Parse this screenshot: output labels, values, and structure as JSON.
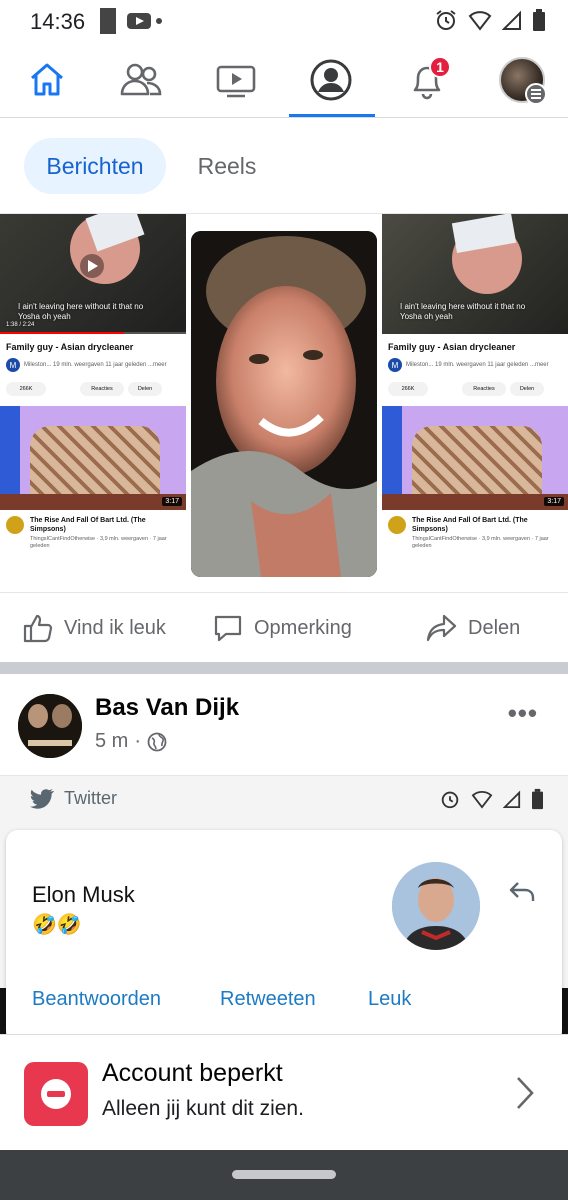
{
  "status_bar": {
    "time": "14:36"
  },
  "nav": {
    "items": [
      {
        "name": "home",
        "icon": "home-icon",
        "active": false
      },
      {
        "name": "friends",
        "icon": "friends-icon",
        "active": false
      },
      {
        "name": "video",
        "icon": "video-icon",
        "active": false
      },
      {
        "name": "profile",
        "icon": "profile-icon",
        "active": true
      },
      {
        "name": "notifications",
        "icon": "bell-icon",
        "active": false
      },
      {
        "name": "menu",
        "icon": "menu-avatar-icon",
        "active": false
      }
    ],
    "notification_count": "1"
  },
  "filter_chips": {
    "posts": "Berichten",
    "reels": "Reels"
  },
  "post1": {
    "yt_left": {
      "subtitle": "I ain't leaving here without it that no\nYosha oh yeah",
      "time": "1:38 / 2:24",
      "title": "Family guy - Asian drycleaner",
      "channel_meta": "Mileston...  19 mln. weergaven  11 jaar geleden  ...meer",
      "likes": "266K",
      "reactions": "Reacties",
      "share": "Delen",
      "title2": "The Rise And Fall Of Bart Ltd. (The Simpsons)",
      "meta2": "ThingsICantFindOtherwise · 3,9 mln. weergaven · 7 jaar geleden",
      "duration": "3:17"
    },
    "yt_right": {
      "subtitle": "I ain't leaving here without it that no\nYosha oh yeah",
      "title": "Family guy - Asian drycleaner",
      "channel_meta": "Mileston...  19 mln. weergaven  11 jaar geleden  ...meer",
      "likes": "266K",
      "reactions": "Reacties",
      "share": "Delen",
      "title2": "The Rise And Fall Of Bart Ltd. (The Simpsons)",
      "meta2": "ThingsICantFindOtherwise · 3,9 mln. weergaven · 7 jaar geleden",
      "duration": "3:17"
    },
    "actions": {
      "like": "Vind ik leuk",
      "comment": "Opmerking",
      "share": "Delen"
    }
  },
  "post2": {
    "author": "Bas Van Dijk",
    "time": "5 m",
    "tweet": {
      "source": "Twitter",
      "name": "Elon Musk",
      "text": "🤣🤣",
      "reply": "Beantwoorden",
      "retweet": "Retweeten",
      "like": "Leuk"
    }
  },
  "restricted": {
    "title": "Account beperkt",
    "subtitle": "Alleen jij kunt dit zien."
  },
  "colors": {
    "accent": "#1877f2",
    "chip_bg": "#e7f3ff",
    "badge": "#e41e3f",
    "restricted_icon": "#e8384f",
    "twitter_blue": "#1d7bc4"
  }
}
